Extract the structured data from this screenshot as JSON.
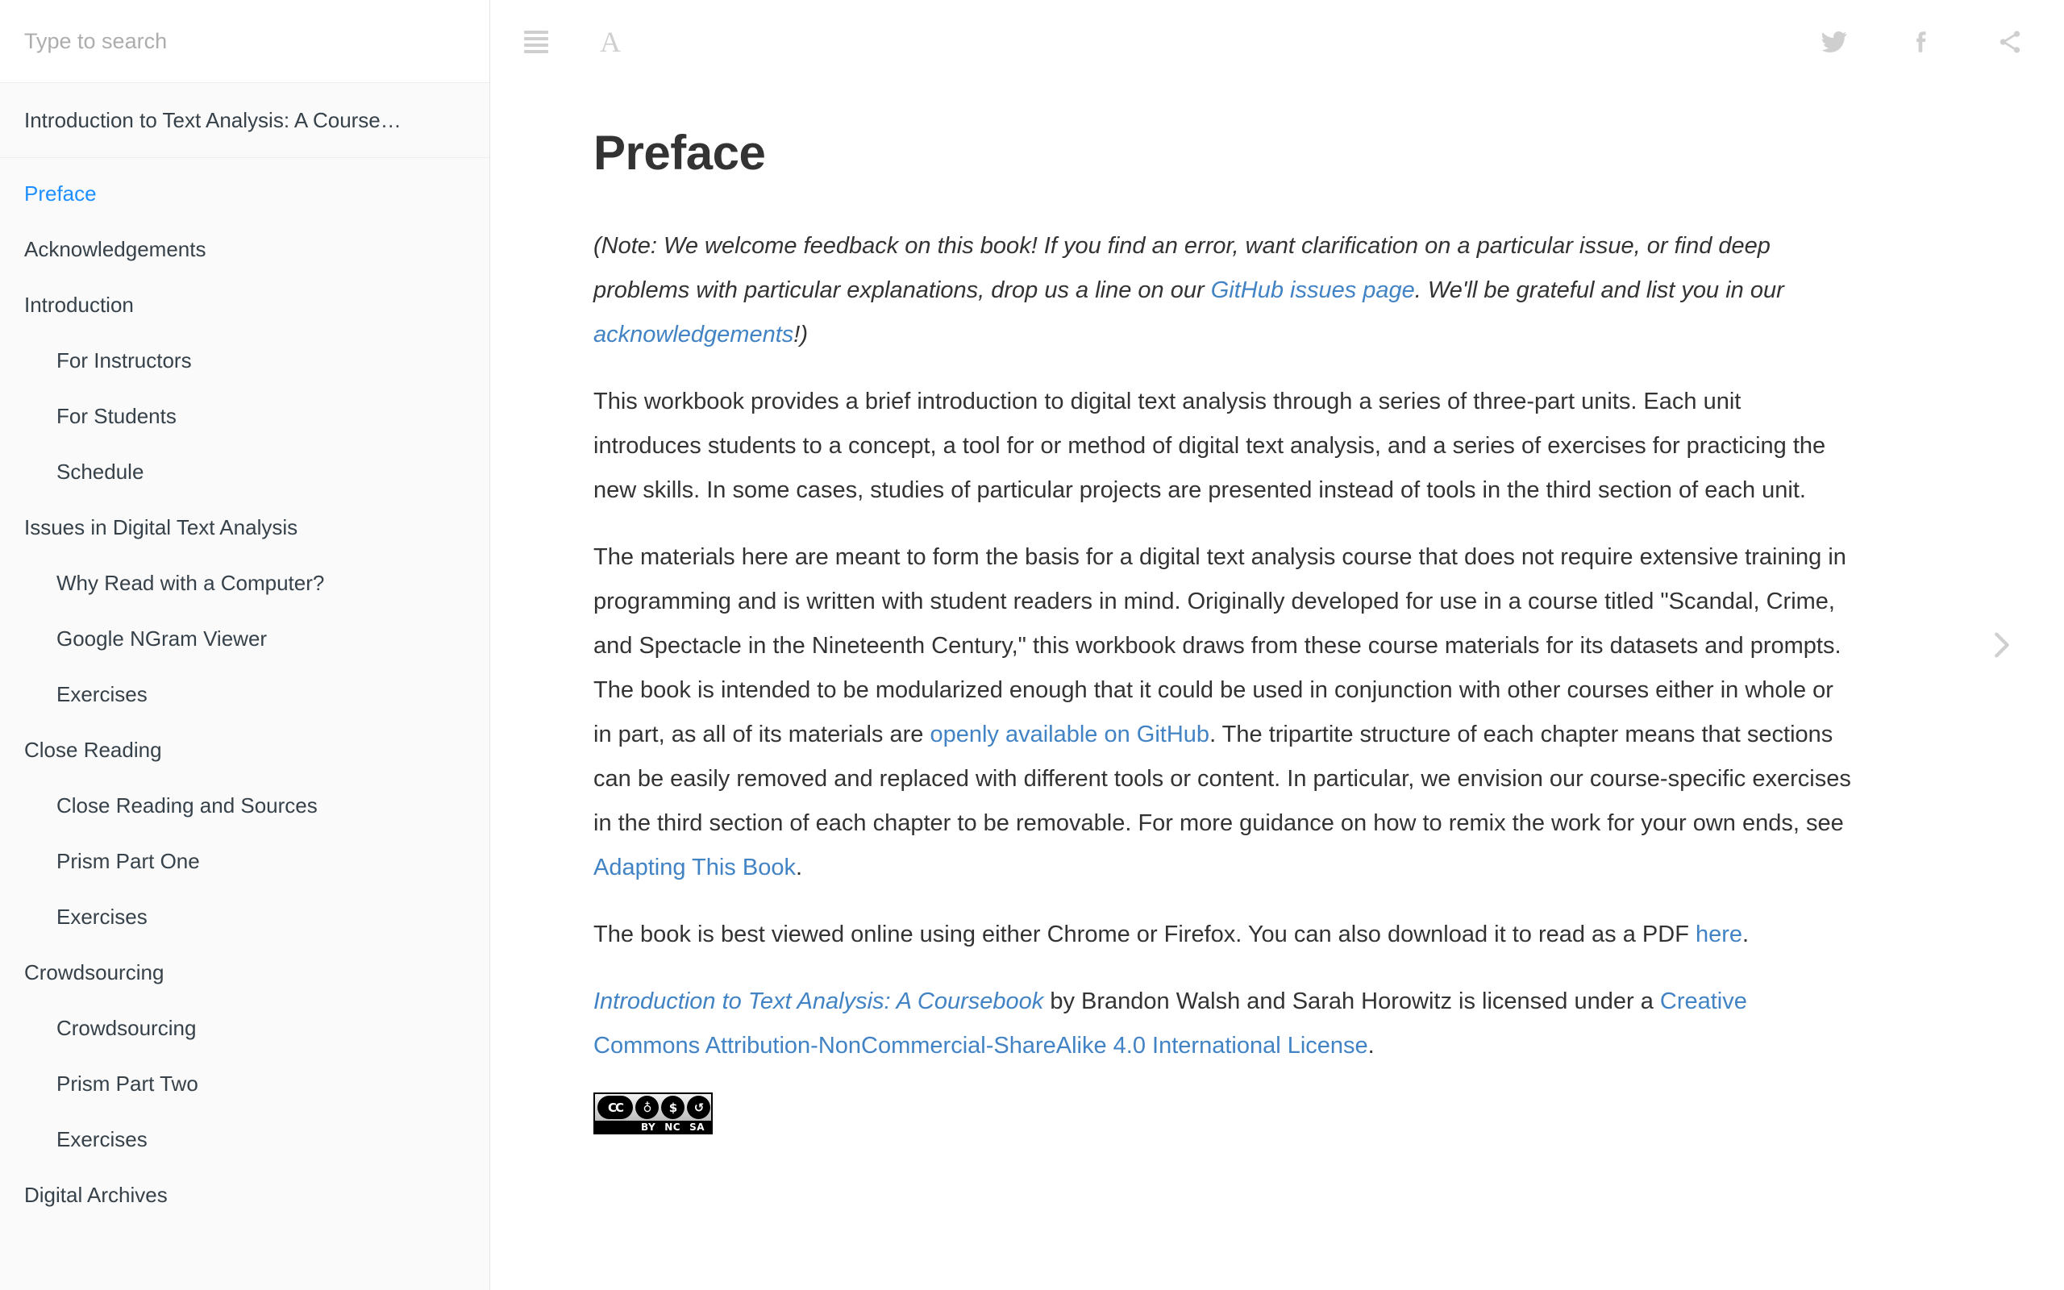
{
  "sidebar": {
    "search": {
      "placeholder": "Type to search",
      "value": ""
    },
    "book_title": "Introduction to Text Analysis: A Course…",
    "toc": [
      {
        "label": "Preface",
        "level": 1,
        "active": true
      },
      {
        "label": "Acknowledgements",
        "level": 1,
        "active": false
      },
      {
        "label": "Introduction",
        "level": 1,
        "active": false
      },
      {
        "label": "For Instructors",
        "level": 2,
        "active": false
      },
      {
        "label": "For Students",
        "level": 2,
        "active": false
      },
      {
        "label": "Schedule",
        "level": 2,
        "active": false
      },
      {
        "label": "Issues in Digital Text Analysis",
        "level": 1,
        "active": false
      },
      {
        "label": "Why Read with a Computer?",
        "level": 2,
        "active": false
      },
      {
        "label": "Google NGram Viewer",
        "level": 2,
        "active": false
      },
      {
        "label": "Exercises",
        "level": 2,
        "active": false
      },
      {
        "label": "Close Reading",
        "level": 1,
        "active": false
      },
      {
        "label": "Close Reading and Sources",
        "level": 2,
        "active": false
      },
      {
        "label": "Prism Part One",
        "level": 2,
        "active": false
      },
      {
        "label": "Exercises",
        "level": 2,
        "active": false
      },
      {
        "label": "Crowdsourcing",
        "level": 1,
        "active": false
      },
      {
        "label": "Crowdsourcing",
        "level": 2,
        "active": false
      },
      {
        "label": "Prism Part Two",
        "level": 2,
        "active": false
      },
      {
        "label": "Exercises",
        "level": 2,
        "active": false
      },
      {
        "label": "Digital Archives",
        "level": 1,
        "active": false
      }
    ]
  },
  "toolbar": {
    "menu_icon": "hamburger-menu-icon",
    "font_icon_label": "A",
    "twitter_icon": "twitter-icon",
    "facebook_icon": "facebook-icon",
    "share_icon": "share-icon"
  },
  "content": {
    "title": "Preface",
    "note": {
      "before_github": "(Note: We welcome feedback on this book! If you find an error, want clarification on a particular issue, or find deep problems with particular explanations, drop us a line on our ",
      "github_link": "GitHub issues page",
      "middle": ". We'll be grateful and list you in our ",
      "ack_link": "acknowledgements",
      "after": "!)"
    },
    "paragraph_1": "This workbook provides a brief introduction to digital text analysis through a series of three-part units. Each unit introduces students to a concept, a tool for or method of digital text analysis, and a series of exercises for practicing the new skills. In some cases, studies of particular projects are presented instead of tools in the third section of each unit.",
    "paragraph_2": {
      "before_github": "The materials here are meant to form the basis for a digital text analysis course that does not require extensive training in programming and is written with student readers in mind. Originally developed for use in a course titled \"Scandal, Crime, and Spectacle in the Nineteenth Century,\" this workbook draws from these course materials for its datasets and prompts. The book is intended to be modularized enough that it could be used in conjunction with other courses either in whole or in part, as all of its materials are ",
      "github_link": "openly available on GitHub",
      "middle": ". The tripartite structure of each chapter means that sections can be easily removed and replaced with different tools or content. In particular, we envision our course-specific exercises in the third section of each chapter to be removable. For more guidance on how to remix the work for your own ends, see ",
      "adapting_link": "Adapting This Book",
      "after": "."
    },
    "paragraph_3": {
      "before_here": "The book is best viewed online using either Chrome or Firefox. You can also download it to read as a PDF ",
      "here_link": "here",
      "after": "."
    },
    "license": {
      "book_link": "Introduction to Text Analysis: A Coursebook",
      "middle": " by Brandon Walsh and Sarah Horowitz is licensed under a ",
      "license_link": "Creative Commons Attribution-NonCommercial-ShareAlike 4.0 International License",
      "after": "."
    },
    "cc_badge": {
      "cc": "CC",
      "by_glyph": "♁",
      "nc_glyph": "$",
      "sa_glyph": "↺",
      "by": "BY",
      "nc": "NC",
      "sa": "SA"
    }
  },
  "navigation": {
    "next_icon": "chevron-right-icon"
  },
  "colors": {
    "link": "#4183c4",
    "active_nav": "#1f8fff",
    "text": "#333333",
    "sidebar_text": "#364149",
    "sidebar_bg": "#fafafa",
    "icon_gray": "#cfcfcf"
  }
}
